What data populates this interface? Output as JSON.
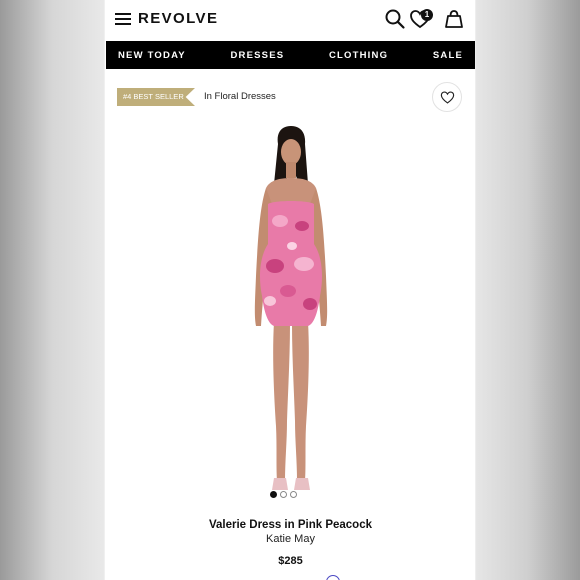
{
  "header": {
    "logo": "REVOLVE",
    "wishlist_count": "1"
  },
  "nav": {
    "items": [
      "NEW TODAY",
      "DRESSES",
      "CLOTHING",
      "SALE"
    ]
  },
  "bestseller": {
    "rank_label": "#4 BEST SELLER",
    "category_text": "In Floral Dresses"
  },
  "product": {
    "title": "Valerie Dress in Pink Peacock",
    "brand": "Katie May",
    "price": "$285",
    "dress_color": "#e87aa8",
    "accent_color": "#bfae7a"
  },
  "gallery": {
    "image_count": 3,
    "active_index": 0
  }
}
